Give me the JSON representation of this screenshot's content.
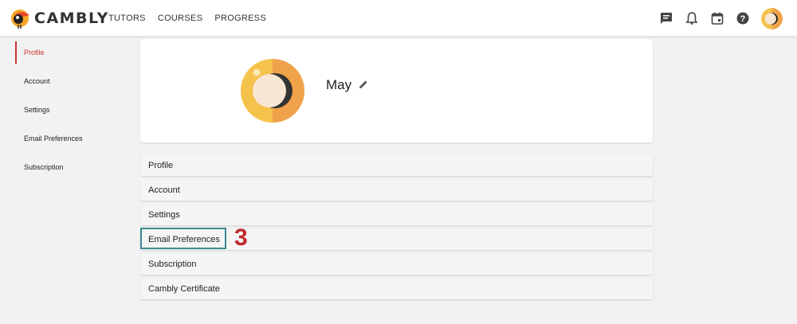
{
  "header": {
    "logo_text": "CAMBLY",
    "nav": [
      "TUTORS",
      "COURSES",
      "PROGRESS"
    ],
    "icons": [
      "chat-icon",
      "bell-icon",
      "calendar-icon",
      "help-icon"
    ]
  },
  "sidebar": {
    "items": [
      {
        "label": "Profile",
        "active": true
      },
      {
        "label": "Account",
        "active": false
      },
      {
        "label": "Settings",
        "active": false
      },
      {
        "label": "Email Preferences",
        "active": false
      },
      {
        "label": "Subscription",
        "active": false
      }
    ]
  },
  "profile": {
    "name": "May"
  },
  "sections": [
    "Profile",
    "Account",
    "Settings",
    "Email Preferences",
    "Subscription",
    "Cambly Certificate"
  ],
  "annotation": {
    "step_number": "3",
    "highlighted_section": "Email Preferences",
    "highlight_color": "#3a8a93",
    "step_color": "#c0282c"
  },
  "colors": {
    "accent_red": "#c8352e",
    "avatar_yellow": "#f5c24c",
    "avatar_orange": "#f0a24a"
  }
}
